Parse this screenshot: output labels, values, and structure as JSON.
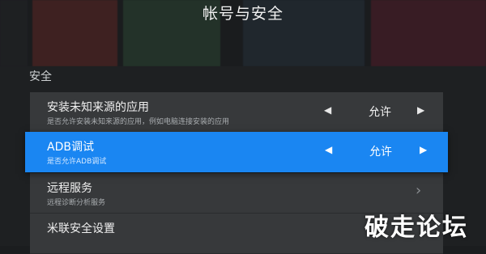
{
  "header": {
    "title": "帐号与安全"
  },
  "section": {
    "label": "安全"
  },
  "settings": [
    {
      "title": "安装未知来源的应用",
      "description": "是否允许安装未知来源的应用，例如电脑连接安装的应用",
      "value": "允许",
      "left_arrow": "◀",
      "right_arrow": "▶"
    },
    {
      "title": "ADB调试",
      "description": "是否允许ADB调试",
      "value": "允许",
      "left_arrow": "◀",
      "right_arrow": "▶"
    },
    {
      "title": "远程服务",
      "description": "远程诊断分析服务",
      "chevron": "›"
    },
    {
      "title": "米联安全设置"
    }
  ],
  "watermark": {
    "text": "破走论坛"
  },
  "colors": {
    "accent": "#1a86f2",
    "row_background": "#3a3c3e",
    "page_background": "#1b1d1f"
  }
}
